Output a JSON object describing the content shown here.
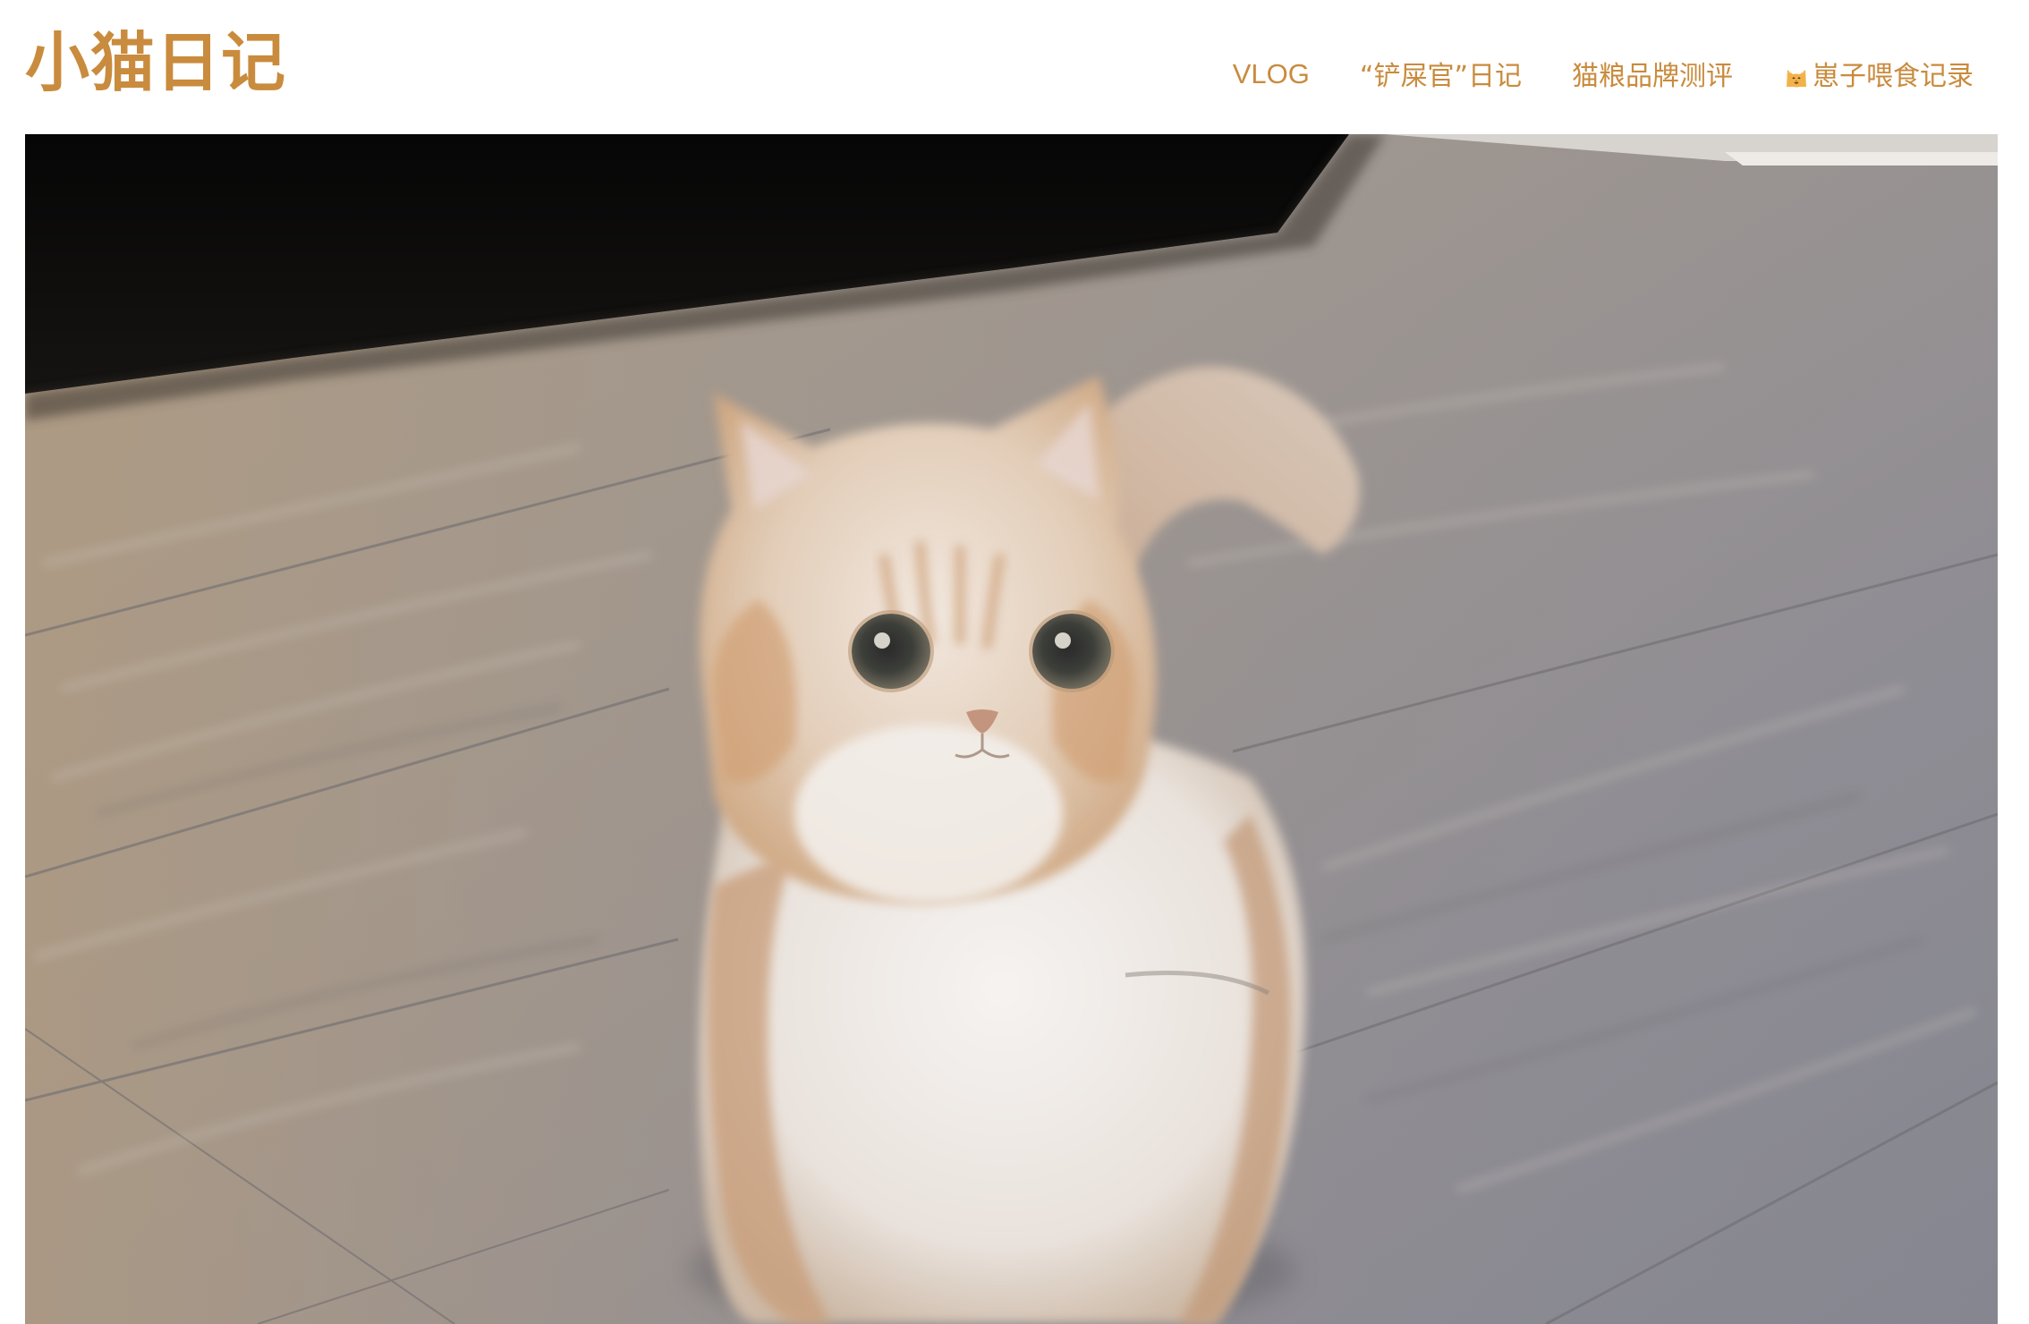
{
  "site": {
    "title": "小猫日记",
    "accent_color": "#c98b3d"
  },
  "nav": {
    "items": [
      {
        "label": "VLOG"
      },
      {
        "label": "“铲屎官”日记"
      },
      {
        "label": "猫粮品牌测评"
      },
      {
        "label": "崽子喂食记录",
        "icon": "cat-face-icon"
      }
    ]
  },
  "hero": {
    "image": "fluffy-orange-white-kitten-on-wooden-floor"
  }
}
